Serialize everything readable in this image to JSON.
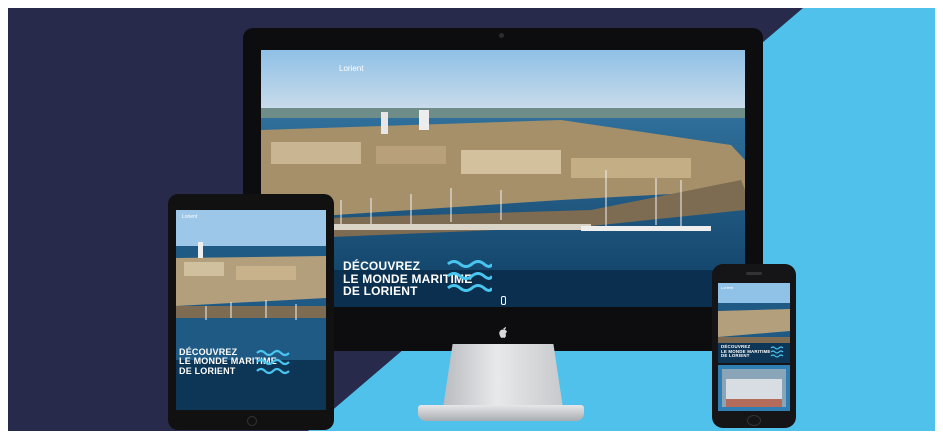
{
  "colors": {
    "navy": "#272a4a",
    "sky": "#4fc1ea",
    "accent": "#49c6f0"
  },
  "site": {
    "logo_text": "Lorient",
    "logo_sub": "",
    "nav_items": [
      "",
      "",
      "",
      "",
      "",
      ""
    ],
    "hero": {
      "line1": "DÉCOUVREZ",
      "line2": "LE MONDE MARITIME",
      "line3": "DE LORIENT"
    }
  },
  "devices": [
    "desktop",
    "tablet",
    "smartphone"
  ]
}
